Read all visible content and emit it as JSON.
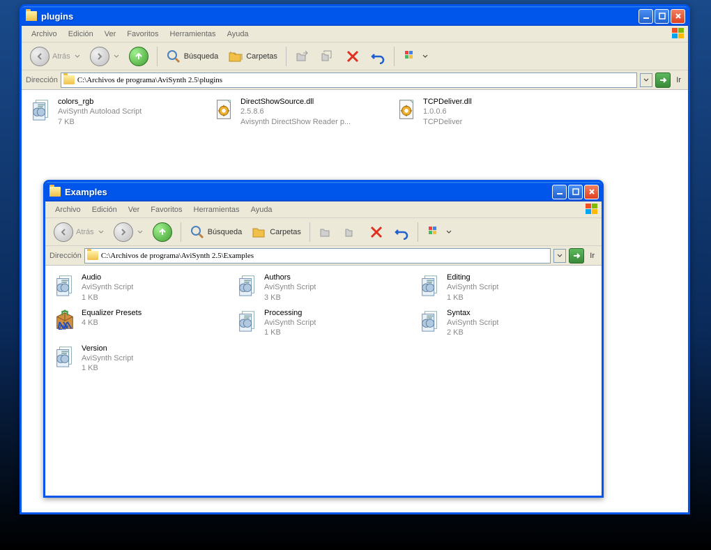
{
  "menus": {
    "archivo": "Archivo",
    "edicion": "Edición",
    "ver": "Ver",
    "favoritos": "Favoritos",
    "herramientas": "Herramientas",
    "ayuda": "Ayuda"
  },
  "toolbar": {
    "atras": "Atrás",
    "busqueda": "Búsqueda",
    "carpetas": "Carpetas"
  },
  "addressbar": {
    "label": "Dirección",
    "go": "Ir"
  },
  "outer": {
    "title": "plugins",
    "path": "C:\\Archivos de programa\\AviSynth 2.5\\plugins",
    "files": [
      {
        "name": "colors_rgb",
        "desc": "AviSynth Autoload Script",
        "size": "7 KB",
        "icon": "script"
      },
      {
        "name": "DirectShowSource.dll",
        "desc": "2.5.8.6",
        "size": "Avisynth DirectShow Reader p...",
        "icon": "dll"
      },
      {
        "name": "TCPDeliver.dll",
        "desc": "1.0.0.6",
        "size": "TCPDeliver",
        "icon": "dll"
      }
    ]
  },
  "inner": {
    "title": "Examples",
    "path": "C:\\Archivos de programa\\AviSynth 2.5\\Examples",
    "files": [
      {
        "name": "Audio",
        "desc": "AviSynth Script",
        "size": "1 KB",
        "icon": "script"
      },
      {
        "name": "Authors",
        "desc": "AviSynth Script",
        "size": "3 KB",
        "icon": "script"
      },
      {
        "name": "Editing",
        "desc": "AviSynth Script",
        "size": "1 KB",
        "icon": "script"
      },
      {
        "name": "Equalizer Presets",
        "desc": "4 KB",
        "size": "",
        "icon": "zip"
      },
      {
        "name": "Processing",
        "desc": "AviSynth Script",
        "size": "1 KB",
        "icon": "script"
      },
      {
        "name": "Syntax",
        "desc": "AviSynth Script",
        "size": "2 KB",
        "icon": "script"
      },
      {
        "name": "Version",
        "desc": "AviSynth Script",
        "size": "1 KB",
        "icon": "script"
      }
    ]
  }
}
